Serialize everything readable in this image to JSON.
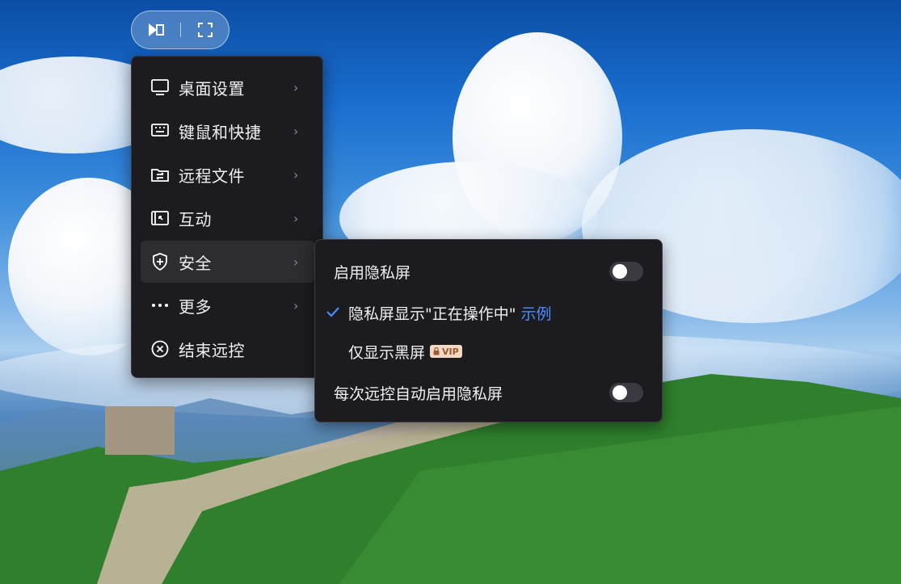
{
  "toolbar": {
    "buttons": [
      {
        "icon": "play-flag-icon"
      },
      {
        "icon": "fullscreen-icon"
      }
    ]
  },
  "menu": {
    "items": [
      {
        "label": "桌面设置",
        "icon": "monitor-icon"
      },
      {
        "label": "键鼠和快捷",
        "icon": "keyboard-icon"
      },
      {
        "label": "远程文件",
        "icon": "folder-transfer-icon"
      },
      {
        "label": "互动",
        "icon": "interaction-icon"
      },
      {
        "label": "安全",
        "icon": "shield-plus-icon",
        "active": true
      },
      {
        "label": "更多",
        "icon": "more-dots-icon"
      },
      {
        "label": "结束远控",
        "icon": "close-circle-icon"
      }
    ]
  },
  "security_submenu": {
    "enable_privacy_label": "启用隐私屏",
    "enable_privacy_on": false,
    "show_operating_label": "隐私屏显示\"正在操作中\"",
    "example_link": "示例",
    "show_operating_checked": true,
    "black_only_label": "仅显示黑屏",
    "vip_badge": "VIP",
    "auto_enable_label": "每次远控自动启用隐私屏",
    "auto_enable_on": false
  },
  "colors": {
    "menu_bg": "#1c1c20",
    "accent": "#4b8cff",
    "vip_bg": "#f3d8c3"
  }
}
